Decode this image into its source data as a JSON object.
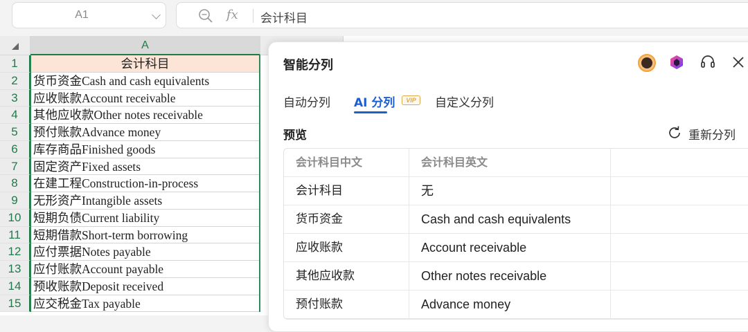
{
  "formula_bar": {
    "cell_ref": "A1",
    "fx_label": "fx",
    "content": "会计科目"
  },
  "sheet": {
    "column_header": "A",
    "rows": [
      {
        "num": "1",
        "value": "会计科目"
      },
      {
        "num": "2",
        "value": "货币资金Cash and cash equivalents"
      },
      {
        "num": "3",
        "value": "应收账款Account receivable"
      },
      {
        "num": "4",
        "value": "其他应收款Other notes receivable"
      },
      {
        "num": "5",
        "value": "预付账款Advance money"
      },
      {
        "num": "6",
        "value": "库存商品Finished goods"
      },
      {
        "num": "7",
        "value": "固定资产Fixed assets"
      },
      {
        "num": "8",
        "value": "在建工程Construction-in-process"
      },
      {
        "num": "9",
        "value": "无形资产Intangible assets"
      },
      {
        "num": "10",
        "value": "短期负债Current liability"
      },
      {
        "num": "11",
        "value": "短期借款Short-term borrowing"
      },
      {
        "num": "12",
        "value": "应付票据Notes payable"
      },
      {
        "num": "13",
        "value": "应付账款Account payable"
      },
      {
        "num": "14",
        "value": "预收账款Deposit received"
      },
      {
        "num": "15",
        "value": "应交税金Tax payable"
      }
    ]
  },
  "panel": {
    "title": "智能分列",
    "tabs": {
      "auto": "自动分列",
      "ai": "AI 分列",
      "vip": "VIP",
      "custom": "自定义分列"
    },
    "preview_label": "预览",
    "resplit_label": "重新分列",
    "table": {
      "headers": [
        "会计科目中文",
        "会计科目英文",
        ""
      ],
      "rows": [
        [
          "会计科目",
          "无",
          ""
        ],
        [
          "货币资金",
          "Cash and cash equivalents",
          ""
        ],
        [
          "应收账款",
          "Account receivable",
          ""
        ],
        [
          "其他应收款",
          "Other notes receivable",
          ""
        ],
        [
          "预付账款",
          "Advance money",
          ""
        ]
      ]
    },
    "icons": [
      "avatar",
      "gem-icon",
      "headset-icon",
      "close-icon"
    ]
  },
  "colors": {
    "accent_green": "#1f7a4a",
    "header_fill": "#fce5d6",
    "tab_blue": "#1d5fd1"
  }
}
